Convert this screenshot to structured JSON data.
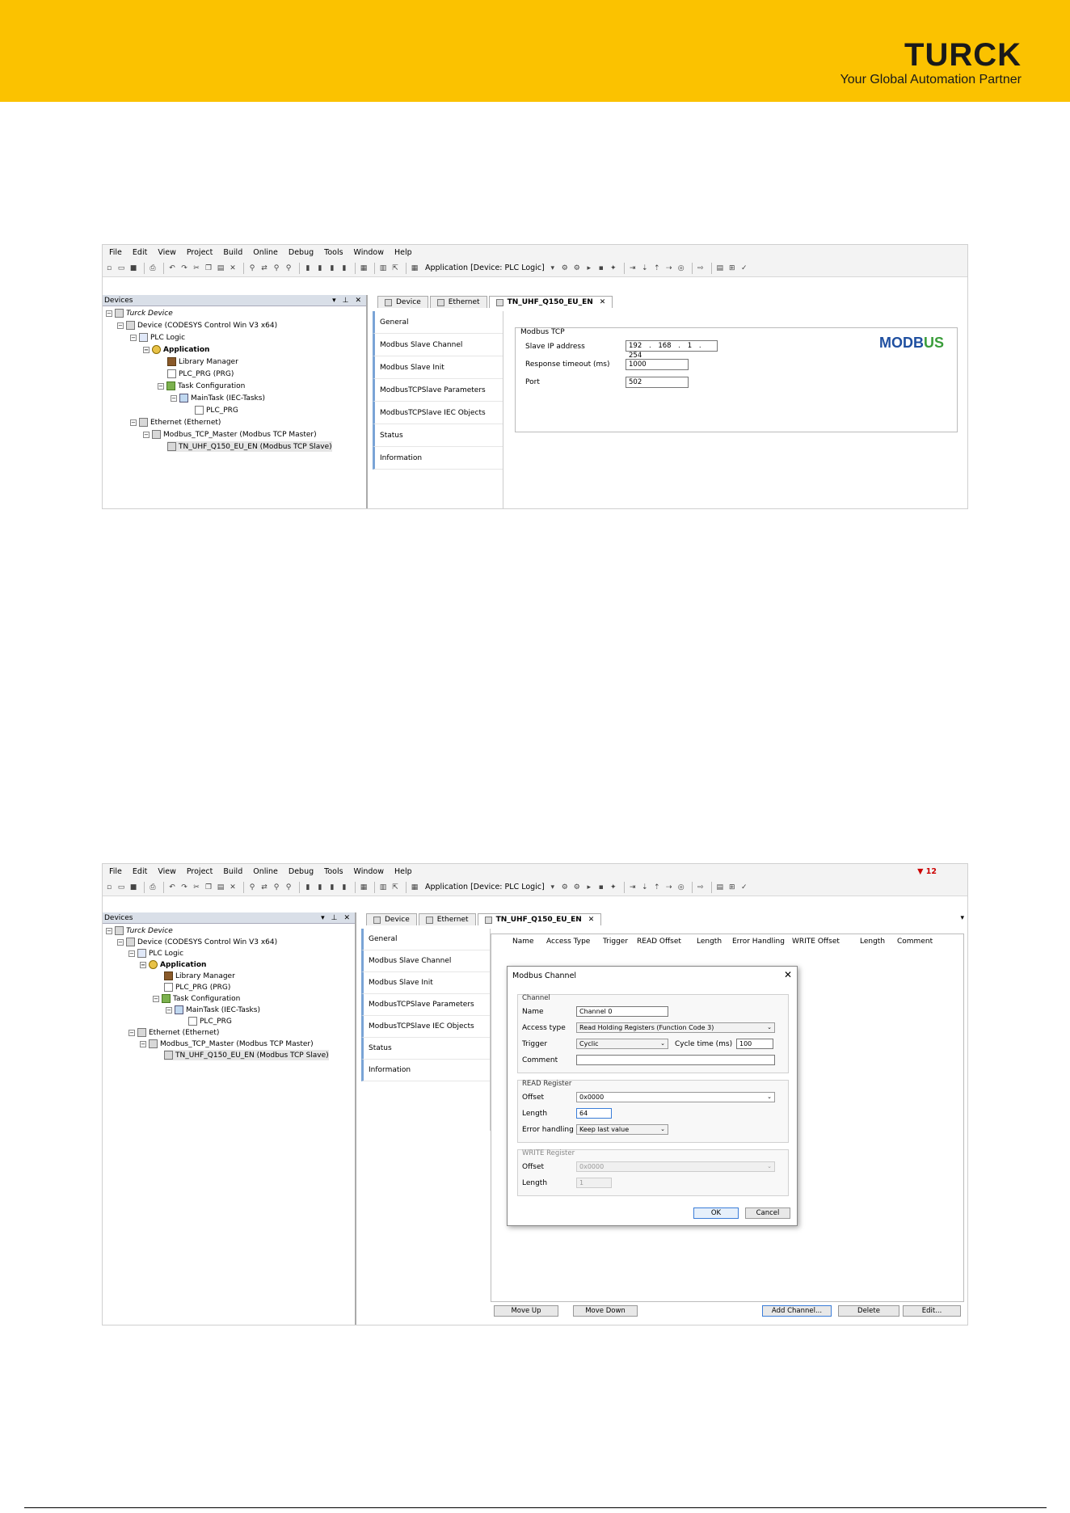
{
  "brand": {
    "name": "TURCK",
    "tagline": "Your Global Automation Partner",
    "banner_color": "#fbc200"
  },
  "menu": [
    "File",
    "Edit",
    "View",
    "Project",
    "Build",
    "Online",
    "Debug",
    "Tools",
    "Window",
    "Help"
  ],
  "toolbar": {
    "application_selector": "Application [Device: PLC Logic]"
  },
  "devices_panel": {
    "title": "Devices",
    "tree": [
      {
        "label": "Turck Device",
        "level": 0,
        "icon": "project-icon"
      },
      {
        "label": "Device (CODESYS Control Win V3 x64)",
        "level": 1,
        "icon": "device-icon"
      },
      {
        "label": "PLC Logic",
        "level": 2,
        "icon": "plc-logic-icon"
      },
      {
        "label": "Application",
        "level": 3,
        "icon": "application-icon"
      },
      {
        "label": "Library Manager",
        "level": 4,
        "icon": "library-icon"
      },
      {
        "label": "PLC_PRG (PRG)",
        "level": 4,
        "icon": "program-icon"
      },
      {
        "label": "Task Configuration",
        "level": 4,
        "icon": "task-config-icon"
      },
      {
        "label": "MainTask (IEC-Tasks)",
        "level": 5,
        "icon": "maintask-icon"
      },
      {
        "label": "PLC_PRG",
        "level": 6,
        "icon": "program-call-icon"
      },
      {
        "label": "Ethernet (Ethernet)",
        "level": 2,
        "icon": "ethernet-icon"
      },
      {
        "label": "Modbus_TCP_Master (Modbus TCP Master)",
        "level": 3,
        "icon": "modbus-master-icon"
      },
      {
        "label": "TN_UHF_Q150_EU_EN (Modbus TCP Slave)",
        "level": 4,
        "icon": "modbus-slave-icon"
      }
    ]
  },
  "editor_tabs": [
    "Device",
    "Ethernet",
    "TN_UHF_Q150_EU_EN"
  ],
  "side_nav": [
    "General",
    "Modbus Slave Channel",
    "Modbus Slave Init",
    "ModbusTCPSlave Parameters",
    "ModbusTCPSlave IEC Objects",
    "Status",
    "Information"
  ],
  "screen1": {
    "active_nav": "General",
    "group_title": "Modbus TCP",
    "slave_ip_label": "Slave IP address",
    "slave_ip": [
      "192",
      "168",
      "1",
      "254"
    ],
    "ip_sep": ".",
    "response_timeout_label": "Response timeout (ms)",
    "response_timeout": "1000",
    "port_label": "Port",
    "port": "502",
    "modbus_logo_a": "MODB",
    "modbus_logo_b": "US"
  },
  "screen2": {
    "active_nav": "Modbus Slave Channel",
    "warning_count": "12",
    "columns": [
      "Name",
      "Access Type",
      "Trigger",
      "READ Offset",
      "Length",
      "Error Handling",
      "WRITE Offset",
      "Length",
      "Comment"
    ],
    "buttons": {
      "move_up": "Move Up",
      "move_down": "Move Down",
      "add_channel": "Add Channel...",
      "delete": "Delete",
      "edit": "Edit..."
    },
    "dialog": {
      "title": "Modbus Channel",
      "channel_group": "Channel",
      "name_label": "Name",
      "name_value": "Channel 0",
      "access_type_label": "Access type",
      "access_type_value": "Read Holding Registers (Function Code 3)",
      "trigger_label": "Trigger",
      "trigger_value": "Cyclic",
      "cycle_time_label": "Cycle time (ms)",
      "cycle_time_value": "100",
      "comment_label": "Comment",
      "comment_value": "",
      "read_group": "READ Register",
      "read_offset_label": "Offset",
      "read_offset_value": "0x0000",
      "read_length_label": "Length",
      "read_length_value": "64",
      "error_handling_label": "Error handling",
      "error_handling_value": "Keep last value",
      "write_group": "WRITE Register",
      "write_offset_label": "Offset",
      "write_offset_value": "0x0000",
      "write_length_label": "Length",
      "write_length_value": "1",
      "ok": "OK",
      "cancel": "Cancel"
    }
  }
}
